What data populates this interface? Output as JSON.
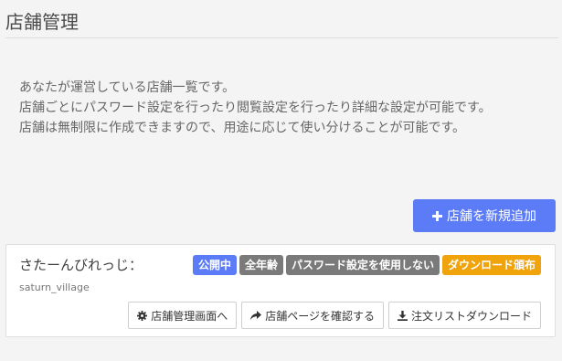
{
  "header": {
    "title": "店舗管理"
  },
  "intro": {
    "lines": [
      "あなたが運営している店舗一覧です。",
      "店舗ごとにパスワード設定を行ったり閲覧設定を行ったり詳細な設定が可能です。",
      "店舗は無制限に作成できますので、用途に応じて使い分けることが可能です。"
    ]
  },
  "add_button": {
    "icon": "plus-icon",
    "label": "店舗を新規追加"
  },
  "shop": {
    "name": "さたーんびれっじ：",
    "id": "saturn_village",
    "badges": [
      {
        "label": "公開中",
        "color": "#5c7cf7"
      },
      {
        "label": "全年齢",
        "color": "#7a7a7a"
      },
      {
        "label": "パスワード設定を使用しない",
        "color": "#7a7a7a"
      },
      {
        "label": "ダウンロード頒布",
        "color": "#f0a30a"
      }
    ],
    "actions": [
      {
        "icon": "gear-icon",
        "label": "店舗管理画面へ"
      },
      {
        "icon": "share-arrow-icon",
        "label": "店舗ページを確認する"
      },
      {
        "icon": "download-icon",
        "label": "注文リストダウンロード"
      }
    ]
  },
  "colors": {
    "background": "#f4f4f4",
    "primary": "#5c7cf7",
    "muted_badge": "#7a7a7a",
    "warning_badge": "#f0a30a"
  }
}
